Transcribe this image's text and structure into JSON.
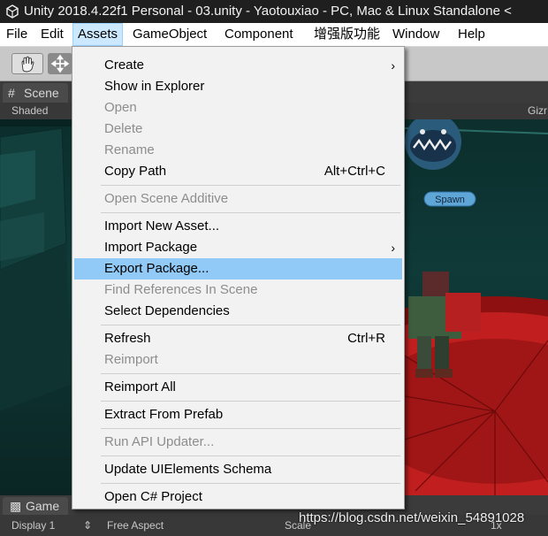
{
  "window": {
    "title": "Unity 2018.4.22f1 Personal - 03.unity - Yaotouxiao - PC, Mac & Linux Standalone <"
  },
  "menubar": {
    "items": [
      "File",
      "Edit",
      "Assets",
      "GameObject",
      "Component",
      "增强版功能",
      "Window",
      "Help"
    ],
    "active": "Assets"
  },
  "scene_panel": {
    "tab_label": "Scene",
    "shading_mode": "Shaded",
    "gizmos_label": "Gizr",
    "spawn_label": "Spawn"
  },
  "game_panel": {
    "tab_label": "Game",
    "display": "Display 1",
    "aspect": "Free Aspect",
    "scale_label": "Scale",
    "scale_value": "1x"
  },
  "assets_menu": {
    "items": [
      {
        "label": "Create",
        "submenu": true
      },
      {
        "label": "Show in Explorer"
      },
      {
        "label": "Open",
        "disabled": true
      },
      {
        "label": "Delete",
        "disabled": true
      },
      {
        "label": "Rename",
        "disabled": true
      },
      {
        "label": "Copy Path",
        "shortcut": "Alt+Ctrl+C"
      },
      {
        "label": "Open Scene Additive",
        "disabled": true
      },
      {
        "label": "Import New Asset..."
      },
      {
        "label": "Import Package",
        "submenu": true
      },
      {
        "label": "Export Package...",
        "highlighted": true
      },
      {
        "label": "Find References In Scene",
        "disabled": true
      },
      {
        "label": "Select Dependencies"
      },
      {
        "label": "Refresh",
        "shortcut": "Ctrl+R"
      },
      {
        "label": "Reimport",
        "disabled": true
      },
      {
        "label": "Reimport All"
      },
      {
        "label": "Extract From Prefab"
      },
      {
        "label": "Run API Updater...",
        "disabled": true
      },
      {
        "label": "Update UIElements Schema"
      },
      {
        "label": "Open C# Project"
      }
    ]
  },
  "watermark": "https://blog.csdn.net/weixin_54891028",
  "colors": {
    "menu_highlight": "#91c9f7",
    "menubar_active": "#cce8ff",
    "disabled_text": "#8d8d8d",
    "floor_red": "#c11f1f",
    "scene_teal": "#0f3a38"
  }
}
